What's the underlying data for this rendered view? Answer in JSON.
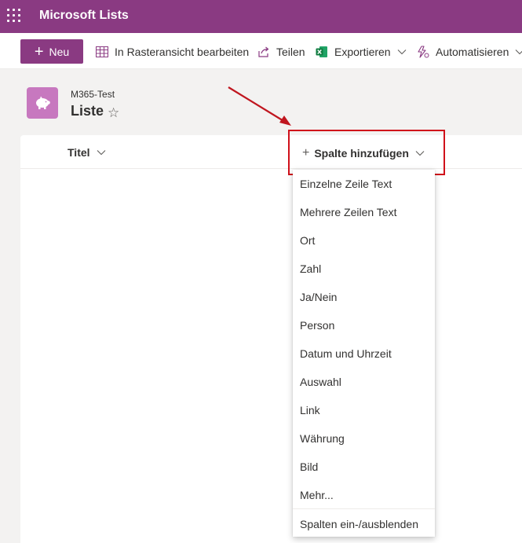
{
  "app": {
    "title": "Microsoft Lists"
  },
  "toolbar": {
    "new_label": "Neu",
    "grid_edit_label": "In Rasteransicht bearbeiten",
    "share_label": "Teilen",
    "export_label": "Exportieren",
    "automate_label": "Automatisieren"
  },
  "list": {
    "site": "M365-Test",
    "name": "Liste"
  },
  "columns": {
    "title_label": "Titel",
    "add_column_label": "Spalte hinzufügen"
  },
  "menu": {
    "items": [
      "Einzelne Zeile Text",
      "Mehrere Zeilen Text",
      "Ort",
      "Zahl",
      "Ja/Nein",
      "Person",
      "Datum und Uhrzeit",
      "Auswahl",
      "Link",
      "Währung",
      "Bild",
      "Mehr..."
    ],
    "footer": "Spalten ein-/ausblenden"
  },
  "colors": {
    "brand": "#8a3a82",
    "list_icon": "#c778bf",
    "highlight": "#d0101a"
  },
  "icons": [
    "waffle-icon",
    "plus-icon",
    "grid-icon",
    "share-icon",
    "excel-icon",
    "chevron-down-icon",
    "automate-icon",
    "piggy-bank-icon",
    "star-icon"
  ]
}
